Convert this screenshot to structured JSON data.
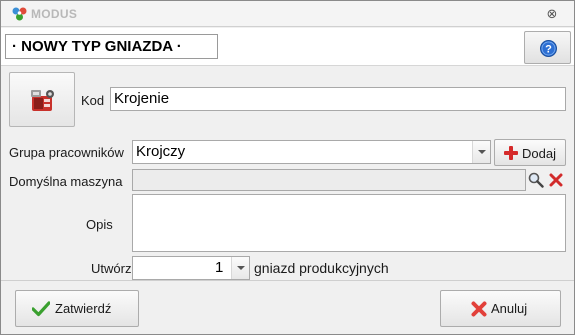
{
  "window": {
    "app_title": "MODUS",
    "close_glyph": "⊗"
  },
  "header": {
    "form_title": "· NOWY TYP GNIAZDA ·",
    "help_icon": "help-icon"
  },
  "form": {
    "kod_label": "Kod",
    "kod_value": "Krojenie",
    "grupa_label": "Grupa pracowników",
    "grupa_value": "Krojczy",
    "dodaj_label": "Dodaj",
    "maszyna_label": "Domyślna maszyna",
    "maszyna_value": "",
    "opis_label": "Opis",
    "opis_value": "",
    "utworz_label": "Utwórz",
    "utworz_value": "1",
    "utworz_suffix": "gniazd produkcyjnych"
  },
  "footer": {
    "confirm_label": "Zatwierdź",
    "cancel_label": "Anuluj"
  },
  "colors": {
    "help_blue": "#2d6fd3",
    "confirm_green": "#3aa02f",
    "cancel_red": "#e2403a",
    "add_red": "#d52a2a"
  }
}
